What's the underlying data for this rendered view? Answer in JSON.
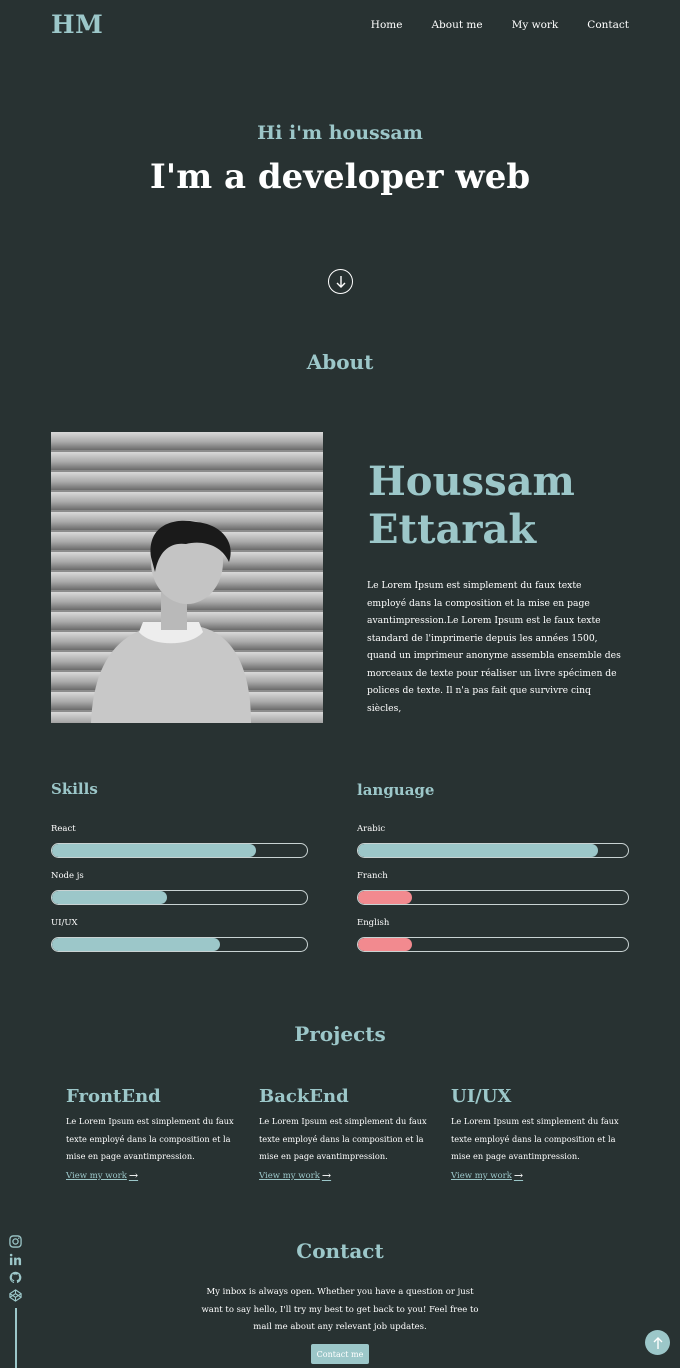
{
  "header": {
    "logo": "HM",
    "nav": [
      "Home",
      "About me",
      "My work",
      "Contact"
    ]
  },
  "hero": {
    "greeting": "Hi i'm houssam",
    "title": "I'm a developer web",
    "scroll_icon": "arrow-down-circle-icon"
  },
  "about": {
    "section_title": "About",
    "name_line1": "Houssam",
    "name_line2": "Ettarak",
    "text": "Le Lorem Ipsum est simplement du faux texte employé dans la composition et la mise en page avantimpression.Le Lorem Ipsum est le faux texte standard de l'imprimerie depuis les années 1500, quand un imprimeur anonyme assembla ensemble des morceaux de texte pour réaliser un livre spécimen de polices de texte. Il n'a pas fait que survivre cinq siècles,"
  },
  "skills": {
    "title": "Skills",
    "items": [
      {
        "label": "React",
        "level": 0.8
      },
      {
        "label": "Node js",
        "level": 0.45
      },
      {
        "label": "UI/UX",
        "level": 0.66
      }
    ]
  },
  "language": {
    "title": "language",
    "items": [
      {
        "label": "Arabic",
        "level": 0.89
      },
      {
        "label": "Franch",
        "level": 0.2
      },
      {
        "label": "English",
        "level": 0.2
      }
    ]
  },
  "projects": {
    "section_title": "Projects",
    "items": [
      {
        "title": "FrontEnd",
        "text": "Le Lorem Ipsum est simplement du faux texte employé dans la composition et la mise en page avantimpression.",
        "link": "View my work"
      },
      {
        "title": "BackEnd",
        "text": "Le Lorem Ipsum est simplement du faux texte employé dans la composition et la mise en page avantimpression.",
        "link": "View my work"
      },
      {
        "title": "UI/UX",
        "text": "Le Lorem Ipsum est simplement du faux texte employé dans la composition et la mise en page avantimpression.",
        "link": "View my work"
      }
    ]
  },
  "contact": {
    "section_title": "Contact",
    "text": "My inbox is always open. Whether you have a question or just want to say hello, I'll try my best to get back to you! Feel free to mail me about any relevant job updates.",
    "button": "Contact me"
  },
  "social_icons": [
    "instagram-icon",
    "linkedin-icon",
    "github-icon",
    "codepen-icon"
  ],
  "colors": {
    "background": "#283232",
    "accent": "#9cc7c9",
    "language_fill_low": "#f28a8f"
  }
}
